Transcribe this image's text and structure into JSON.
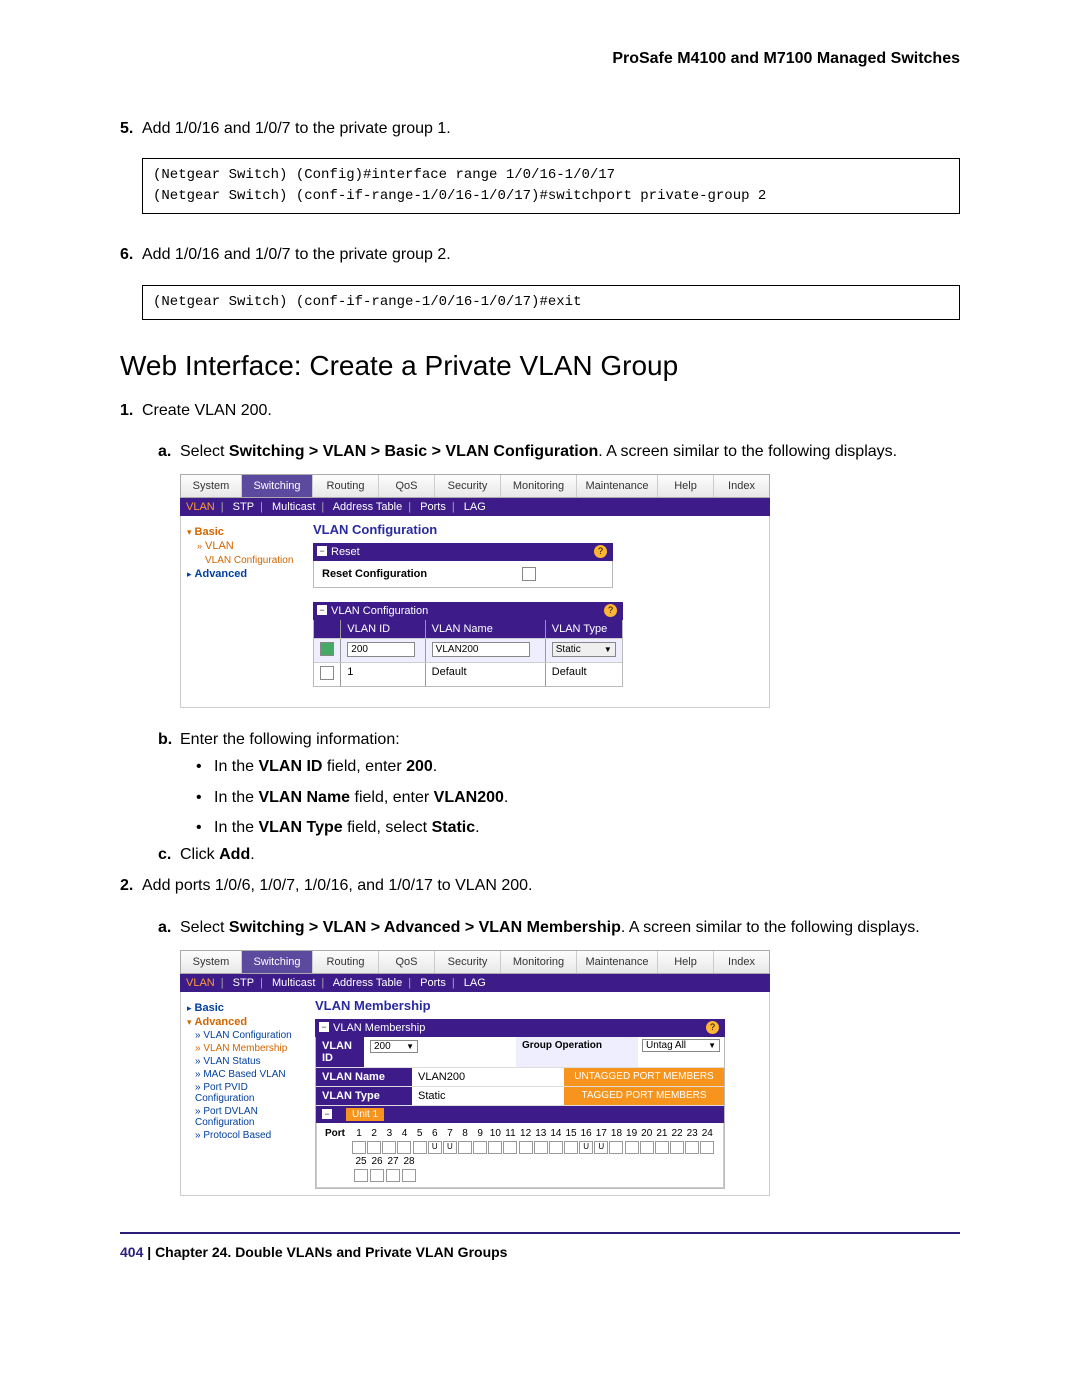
{
  "header": "ProSafe M4100 and M7100 Managed Switches",
  "step5": {
    "num": "5.",
    "text": "Add 1/0/16 and 1/0/7 to the private group 1."
  },
  "code1": "(Netgear Switch) (Config)#interface range 1/0/16-1/0/17\n(Netgear Switch) (conf-if-range-1/0/16-1/0/17)#switchport private-group 2",
  "step6": {
    "num": "6.",
    "text": "Add 1/0/16 and 1/0/7 to the private group 2."
  },
  "code2": "(Netgear Switch) (conf-if-range-1/0/16-1/0/17)#exit",
  "sectionHeading": "Web Interface: Create a Private VLAN Group",
  "step1": {
    "num": "1.",
    "text": "Create VLAN 200."
  },
  "step1a": {
    "letter": "a.",
    "prefix": "Select ",
    "boldpath": "Switching > VLAN > Basic > VLAN Configuration",
    "suffix": ". A screen similar to the following displays."
  },
  "step1b": {
    "letter": "b.",
    "text": "Enter the following information:"
  },
  "bullets": {
    "b1a": "In the ",
    "b1b": "VLAN ID",
    "b1c": " field, enter ",
    "b1d": "200",
    "b1e": ".",
    "b2a": "In the ",
    "b2b": "VLAN Name",
    "b2c": " field, enter ",
    "b2d": "VLAN200",
    "b2e": ".",
    "b3a": "In the ",
    "b3b": "VLAN Type",
    "b3c": " field, select ",
    "b3d": "Static",
    "b3e": "."
  },
  "step1c": {
    "letter": "c.",
    "pre": "Click ",
    "bold": "Add",
    "post": "."
  },
  "step2": {
    "num": "2.",
    "text": "Add ports 1/0/6, 1/0/7, 1/0/16, and 1/0/17 to VLAN 200."
  },
  "step2a": {
    "letter": "a.",
    "prefix": "Select ",
    "boldpath": "Switching > VLAN > Advanced > VLAN Membership",
    "suffix": ". A screen similar to the following displays."
  },
  "tabs": [
    "System",
    "Switching",
    "Routing",
    "QoS",
    "Security",
    "Monitoring",
    "Maintenance",
    "Help",
    "Index"
  ],
  "subtabs1": {
    "vlan": "VLAN",
    "stp": "STP",
    "multicast": "Multicast",
    "addrtable": "Address Table",
    "ports": "Ports",
    "lag": "LAG"
  },
  "ss1": {
    "side": {
      "basic": "Basic",
      "vlanConf": "VLAN Configuration",
      "advanced": "Advanced",
      "vlan": "VLAN"
    },
    "panelTitle": "VLAN Configuration",
    "reset": "Reset",
    "resetConf": "Reset Configuration",
    "vlanConfHeader": "VLAN Configuration",
    "th": {
      "id": "VLAN ID",
      "name": "VLAN Name",
      "type": "VLAN Type"
    },
    "rowInput": {
      "id": "200",
      "name": "VLAN200",
      "type": "Static"
    },
    "rowDef": {
      "id": "1",
      "name": "Default",
      "type": "Default"
    }
  },
  "ss2": {
    "side": {
      "basic": "Basic",
      "advanced": "Advanced",
      "vlanConf": "VLAN Configuration",
      "vlanMem": "VLAN Membership",
      "vlanStatus": "VLAN Status",
      "macVlan": "MAC Based VLAN",
      "portPvid": "Port PVID Configuration",
      "portDvlan": "Port DVLAN Configuration",
      "protocol": "Protocol Based"
    },
    "title": "VLAN Membership",
    "header": "VLAN Membership",
    "rows": {
      "vlanIdLabel": "VLAN ID",
      "vlanIdVal": "200",
      "vlanNameLabel": "VLAN Name",
      "vlanNameVal": "VLAN200",
      "vlanTypeLabel": "VLAN Type",
      "vlanTypeVal": "Static",
      "groupOp": "Group Operation",
      "untagAll": "Untag All",
      "untaggedBtn": "UNTAGGED PORT MEMBERS",
      "taggedBtn": "TAGGED PORT MEMBERS"
    },
    "unit": "Unit 1",
    "portLabel": "Port",
    "ports1": [
      "1",
      "2",
      "3",
      "4",
      "5",
      "6",
      "7",
      "8",
      "9",
      "10",
      "11",
      "12",
      "13",
      "14",
      "15",
      "16",
      "17",
      "18",
      "19",
      "20",
      "21",
      "22",
      "23",
      "24"
    ],
    "ports2": [
      "25",
      "26",
      "27",
      "28"
    ]
  },
  "footer": {
    "page": "404",
    "sep": "  |  ",
    "chapter": "Chapter 24.  Double VLANs and Private VLAN Groups"
  }
}
